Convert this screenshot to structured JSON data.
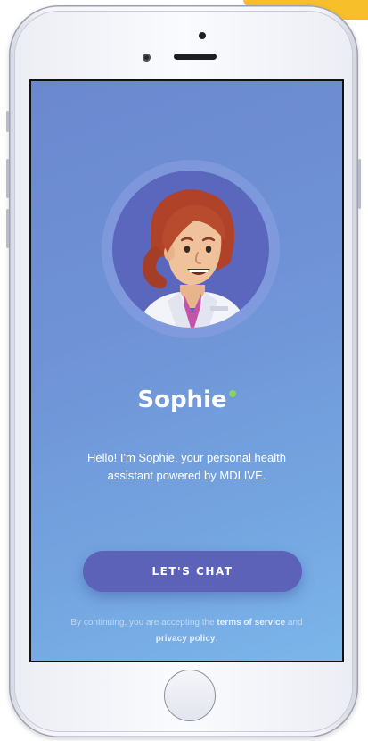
{
  "accent_color": "#f7c02b",
  "screen_gradient": [
    "#6b88cf",
    "#7bb6ea"
  ],
  "assistant": {
    "name": "Sophie",
    "status": "online",
    "status_color": "#8bd35a",
    "intro_line1": "Hello! I'm Sophie, your personal health",
    "intro_line2": "assistant powered by MDLIVE."
  },
  "cta": {
    "label": "LET'S CHAT",
    "color": "#5b62b8"
  },
  "legal": {
    "prefix": "By continuing, you are accepting the",
    "terms_link": "terms of service",
    "and_text": "and",
    "privacy_link": "privacy policy",
    "suffix": "."
  },
  "icons": {
    "avatar": "doctor-avatar-illustration",
    "status": "online-status-dot"
  }
}
